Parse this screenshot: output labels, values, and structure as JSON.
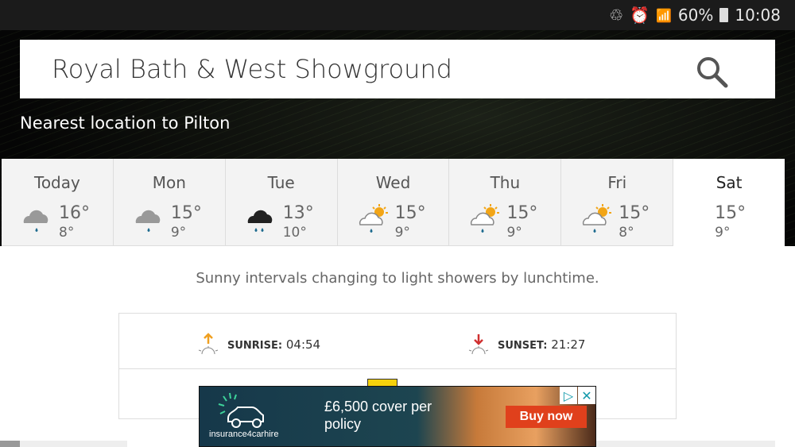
{
  "status": {
    "battery": "60%",
    "time": "10:08"
  },
  "search": {
    "value": "Royal Bath & West Showground"
  },
  "nearest": "Nearest location to Pilton",
  "days": [
    {
      "day": "Today",
      "hi": "16°",
      "lo": "8°",
      "icon": "grey-cloud-light-rain"
    },
    {
      "day": "Mon",
      "hi": "15°",
      "lo": "9°",
      "icon": "grey-cloud-light-rain"
    },
    {
      "day": "Tue",
      "hi": "13°",
      "lo": "10°",
      "icon": "black-cloud-heavy-rain"
    },
    {
      "day": "Wed",
      "hi": "15°",
      "lo": "9°",
      "icon": "sunny-intervals-shower"
    },
    {
      "day": "Thu",
      "hi": "15°",
      "lo": "9°",
      "icon": "sunny-intervals-shower"
    },
    {
      "day": "Fri",
      "hi": "15°",
      "lo": "8°",
      "icon": "sunny-intervals-shower"
    },
    {
      "day": "Sat",
      "hi": "15°",
      "lo": "9°",
      "icon": "none",
      "active": true
    }
  ],
  "summary": "Sunny intervals changing to light showers by lunchtime.",
  "sun": {
    "sunrise_label": "SUNRISE:",
    "sunrise": "04:54",
    "sunset_label": "SUNSET:",
    "sunset": "21:27"
  },
  "ad": {
    "text": "£6,500 cover per policy",
    "brand": "insurance4carhire",
    "button": "Buy now"
  }
}
